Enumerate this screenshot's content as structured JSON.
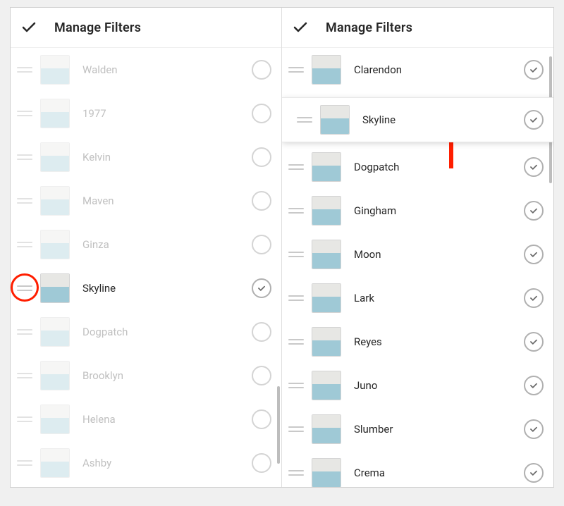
{
  "left": {
    "title": "Manage Filters",
    "filters": [
      {
        "name": "Walden",
        "checked": false,
        "dimmed": true
      },
      {
        "name": "1977",
        "checked": false,
        "dimmed": true
      },
      {
        "name": "Kelvin",
        "checked": false,
        "dimmed": true
      },
      {
        "name": "Maven",
        "checked": false,
        "dimmed": true
      },
      {
        "name": "Ginza",
        "checked": false,
        "dimmed": true
      },
      {
        "name": "Skyline",
        "checked": true,
        "dimmed": false
      },
      {
        "name": "Dogpatch",
        "checked": false,
        "dimmed": true
      },
      {
        "name": "Brooklyn",
        "checked": false,
        "dimmed": true
      },
      {
        "name": "Helena",
        "checked": false,
        "dimmed": true
      },
      {
        "name": "Ashby",
        "checked": false,
        "dimmed": true
      }
    ],
    "circle_index": 5
  },
  "right": {
    "title": "Manage Filters",
    "filters": [
      {
        "name": "Clarendon",
        "checked": true,
        "dimmed": false,
        "lifted": false
      },
      {
        "name": "Skyline",
        "checked": true,
        "dimmed": false,
        "lifted": true
      },
      {
        "name": "Dogpatch",
        "checked": true,
        "dimmed": false,
        "lifted": false
      },
      {
        "name": "Gingham",
        "checked": true,
        "dimmed": false,
        "lifted": false
      },
      {
        "name": "Moon",
        "checked": true,
        "dimmed": false,
        "lifted": false
      },
      {
        "name": "Lark",
        "checked": true,
        "dimmed": false,
        "lifted": false
      },
      {
        "name": "Reyes",
        "checked": true,
        "dimmed": false,
        "lifted": false
      },
      {
        "name": "Juno",
        "checked": true,
        "dimmed": false,
        "lifted": false
      },
      {
        "name": "Slumber",
        "checked": true,
        "dimmed": false,
        "lifted": false
      },
      {
        "name": "Crema",
        "checked": true,
        "dimmed": false,
        "lifted": false
      }
    ],
    "arrow_below_index": 1
  },
  "colors": {
    "annotation_red": "#ff1e00"
  }
}
